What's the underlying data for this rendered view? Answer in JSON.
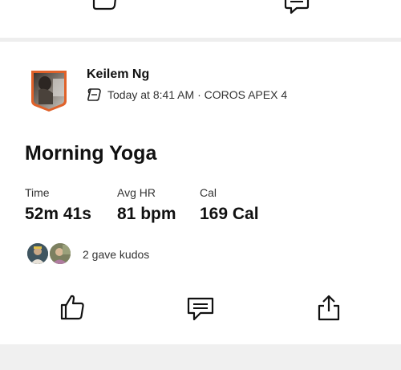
{
  "post": {
    "athlete_name": "Keilem Ng",
    "meta": "Today at 8:41 AM · COROS APEX 4",
    "activity_icon": "yoga-mat-icon",
    "title": "Morning Yoga",
    "stats": [
      {
        "label": "Time",
        "value": "52m 41s"
      },
      {
        "label": "Avg HR",
        "value": "81 bpm"
      },
      {
        "label": "Cal",
        "value": "169 Cal"
      }
    ],
    "kudos_text": "2 gave kudos"
  },
  "actions": {
    "kudos_icon": "thumbs-up-icon",
    "comment_icon": "comment-icon",
    "share_icon": "share-icon"
  },
  "colors": {
    "avatar_frame": "#e0622a",
    "divider": "#eeeeee",
    "bottom_band": "#f0f0f0"
  }
}
